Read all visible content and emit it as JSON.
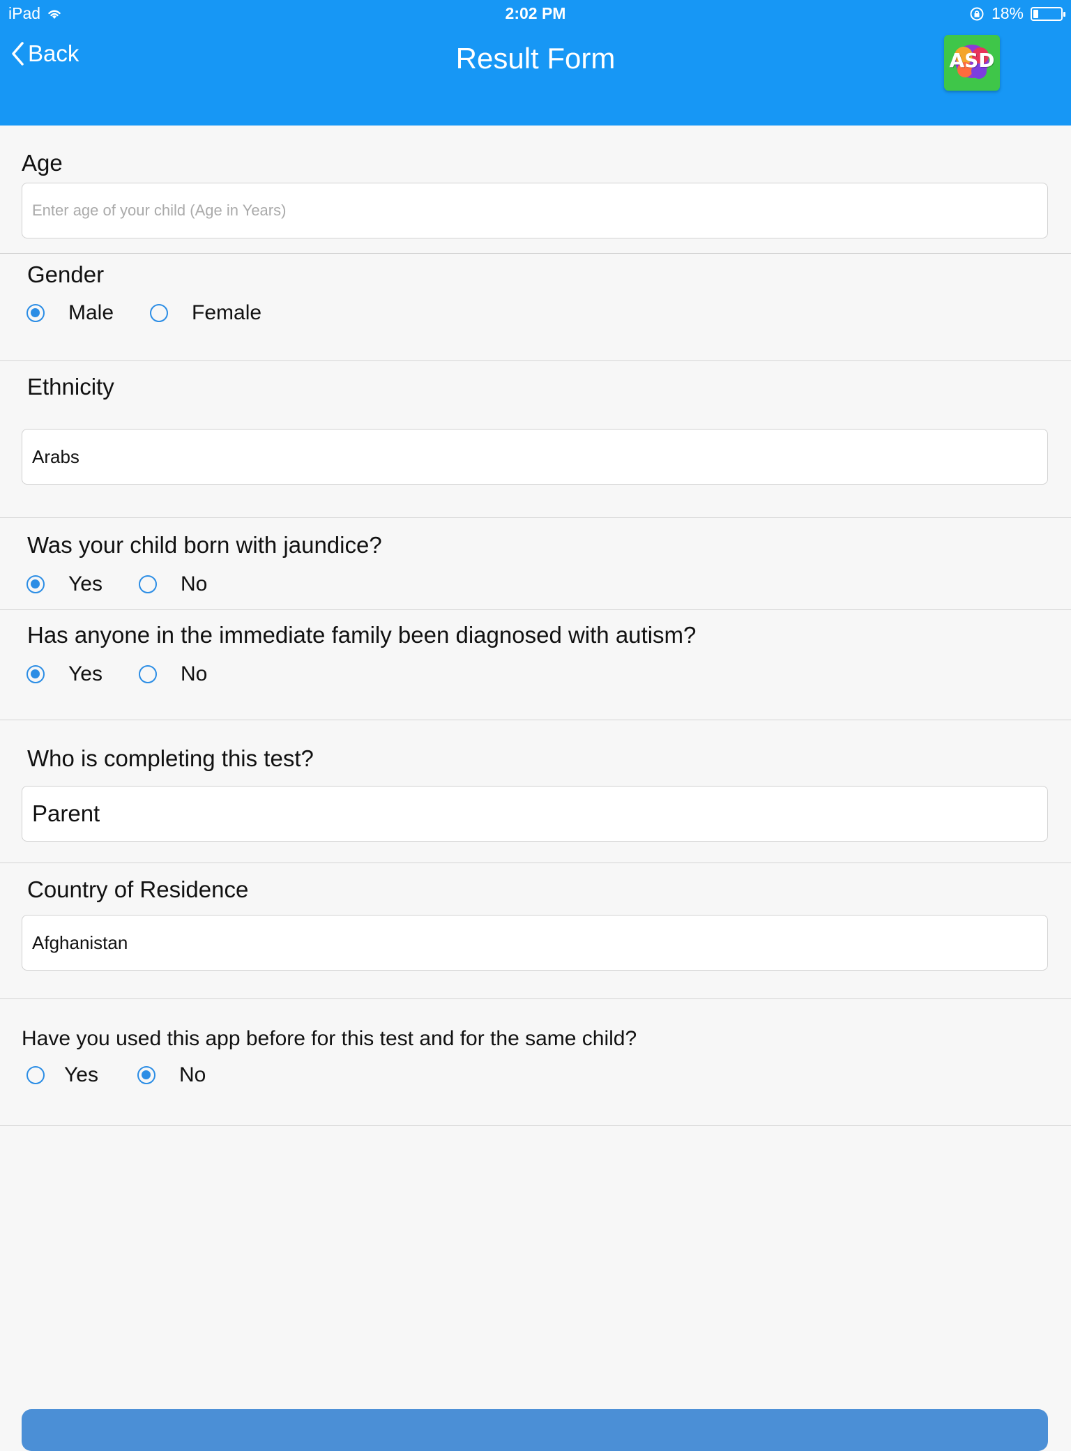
{
  "status_bar": {
    "device": "iPad",
    "time": "2:02 PM",
    "battery": "18%",
    "battery_level": 0.18
  },
  "nav": {
    "back_label": "Back",
    "title": "Result Form",
    "logo_text": "ASD"
  },
  "form": {
    "age": {
      "label": "Age",
      "placeholder": "Enter age of your child (Age in Years)",
      "value": ""
    },
    "gender": {
      "label": "Gender",
      "options": [
        "Male",
        "Female"
      ],
      "selected": "Male"
    },
    "ethnicity": {
      "label": "Ethnicity",
      "value": "Arabs"
    },
    "jaundice": {
      "label": "Was your child born with jaundice?",
      "options": [
        "Yes",
        "No"
      ],
      "selected": "Yes"
    },
    "family_autism": {
      "label": "Has anyone in the immediate family been diagnosed with autism?",
      "options": [
        "Yes",
        "No"
      ],
      "selected": "Yes"
    },
    "who_completing": {
      "label": "Who is completing this test?",
      "value": "Parent"
    },
    "country": {
      "label": "Country of Residence",
      "value": "Afghanistan"
    },
    "used_before": {
      "label": "Have you used this app before for this test and for the same child?",
      "options": [
        "Yes",
        "No"
      ],
      "selected": "No"
    }
  },
  "colors": {
    "header": "#1797f5",
    "radio": "#2b8de5",
    "bottom_button": "#4b8fd6"
  }
}
